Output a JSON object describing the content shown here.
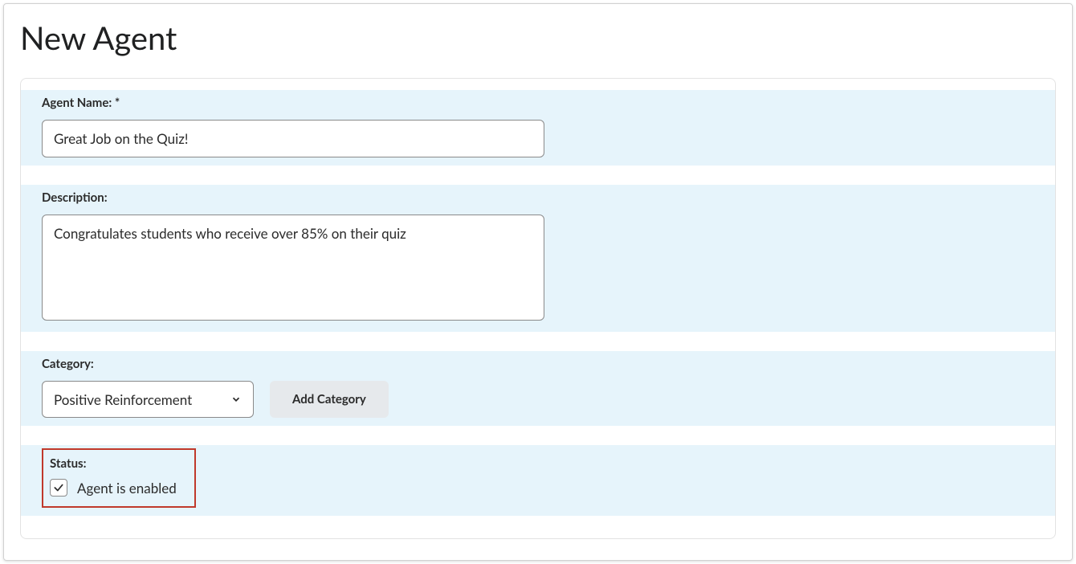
{
  "page": {
    "title": "New Agent"
  },
  "agent_name": {
    "label": "Agent Name: *",
    "value": "Great Job on the Quiz!"
  },
  "description": {
    "label": "Description:",
    "value": "Congratulates students who receive over 85% on their quiz"
  },
  "category": {
    "label": "Category:",
    "selected": "Positive Reinforcement",
    "add_button": "Add Category"
  },
  "status": {
    "label": "Status:",
    "checkbox_label": "Agent is enabled",
    "checked": true
  }
}
